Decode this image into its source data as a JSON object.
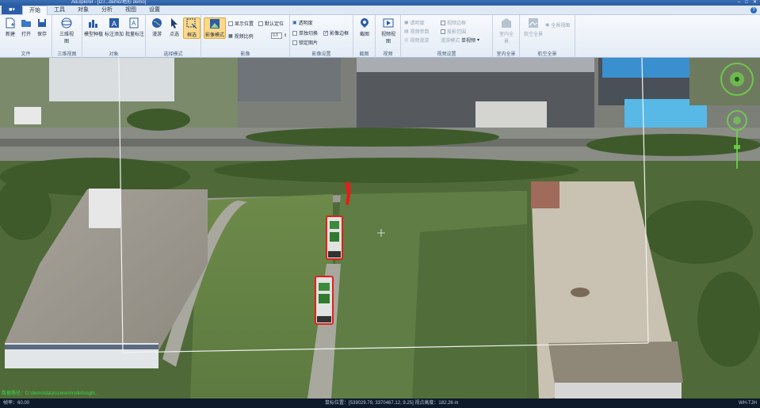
{
  "window": {
    "title": "AiExplorer - [D:/...demo/地形 demo]"
  },
  "menu": {
    "app_label": "■▾",
    "tabs": [
      "开始",
      "工具",
      "对象",
      "分析",
      "视图",
      "设置"
    ],
    "active": "开始"
  },
  "ribbon": {
    "file": {
      "label": "文件",
      "buttons": [
        "新建",
        "打开",
        "保存"
      ]
    },
    "scene": {
      "label": "三维视图",
      "buttons": [
        "三维视图"
      ]
    },
    "object": {
      "label": "对象",
      "buttons": [
        "模型种植",
        "标注添加",
        "批量标注"
      ]
    },
    "select": {
      "label": "选择模式",
      "buttons": [
        "漫游",
        "点选",
        "框选"
      ]
    },
    "image": {
      "label": "影像",
      "button": "影像模式",
      "options": [
        "显示位置",
        "默认定位",
        "视频比例"
      ],
      "ratio_value": "0.0"
    },
    "image_settings": {
      "label": "影像设置",
      "items": [
        "透明度",
        "单独切换",
        "影像边框",
        "锁定图片"
      ]
    },
    "capture": {
      "label": "截图",
      "button": "截图"
    },
    "video": {
      "label": "视频",
      "button": "视频视图"
    },
    "video_settings": {
      "label": "视频设置",
      "items": [
        "透明度",
        "视频边框",
        "视频参数",
        "投影范围",
        "视频漫游",
        "漫游模式",
        "单视频"
      ]
    },
    "indoor": {
      "label": "室内全景",
      "button": "室内全景"
    },
    "aerial": {
      "label": "航空全景",
      "buttons": [
        "航空全景",
        "全景视图"
      ]
    }
  },
  "status": {
    "frame_rate": "帧率：60.00",
    "coords": "鼠标位置：[539029.79, 3370467.12, 9.25]  视点高度：182.26 m",
    "right_label": "WH-TJH",
    "overlay": "数据路径：D:\\demo\\data\\scene\\model\\osgb\\..."
  },
  "colors": {
    "accent": "#2b5da8",
    "selected": "#fbd88a",
    "highlight_red": "#e0201c"
  }
}
